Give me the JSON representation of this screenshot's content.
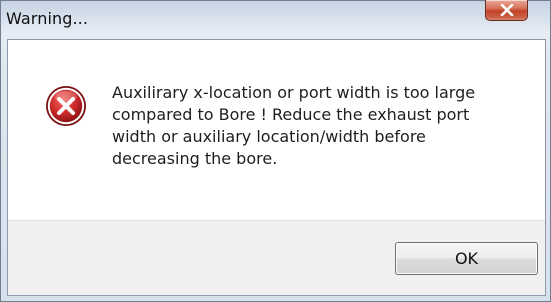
{
  "dialog": {
    "title": "Warning...",
    "close_icon": "close-x-icon",
    "message_icon": "error-icon",
    "message": "Auxilirary x-location or port width is too large compared to Bore ! Reduce the exhaust port width or auxiliary location/width before decreasing the bore.",
    "ok_label": "OK"
  },
  "colors": {
    "close_button": "#c1432a",
    "error_icon": "#c2262a",
    "frame_border": "#6f7f91"
  }
}
